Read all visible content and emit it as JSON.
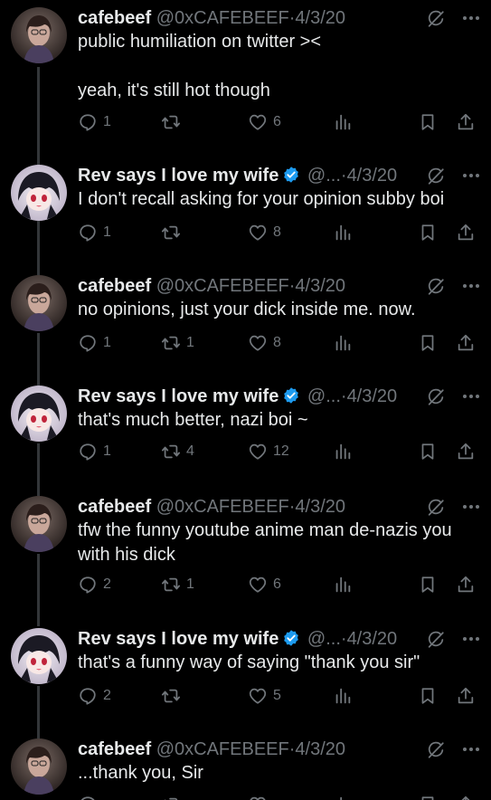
{
  "colors": {
    "background": "#000000",
    "text": "#e7e9ea",
    "muted": "#71767b",
    "verified": "#1d9bf0",
    "thread_line": "#333639"
  },
  "icons": [
    "reply-icon",
    "retweet-icon",
    "like-icon",
    "views-icon",
    "bookmark-icon",
    "share-icon",
    "grok-icon",
    "more-icon",
    "verified-badge-icon"
  ],
  "tweets": [
    {
      "author": "cafebeef",
      "handle": "@0xCAFEBEEF",
      "sep": "·",
      "date": "4/3/20",
      "text": "public humiliation on twitter ><\n\nyeah, it's still hot though",
      "replies": "1",
      "retweets": "",
      "likes": "6"
    },
    {
      "author": "Rev says I love my wife",
      "handle": "@...",
      "sep": "·",
      "date": "4/3/20",
      "text": "I don't recall asking for your opinion subby boi",
      "replies": "1",
      "retweets": "",
      "likes": "8"
    },
    {
      "author": "cafebeef",
      "handle": "@0xCAFEBEEF",
      "sep": "·",
      "date": "4/3/20",
      "text": "no opinions, just your dick inside me. now.",
      "replies": "1",
      "retweets": "1",
      "likes": "8"
    },
    {
      "author": "Rev says I love my wife",
      "handle": "@...",
      "sep": "·",
      "date": "4/3/20",
      "text": "that's much better, nazi boi ~",
      "replies": "1",
      "retweets": "4",
      "likes": "12"
    },
    {
      "author": "cafebeef",
      "handle": "@0xCAFEBEEF",
      "sep": "·",
      "date": "4/3/20",
      "text": "tfw the funny youtube anime man de-nazis you with his dick",
      "replies": "2",
      "retweets": "1",
      "likes": "6"
    },
    {
      "author": "Rev says I love my wife",
      "handle": "@...",
      "sep": "·",
      "date": "4/3/20",
      "text": "that's a funny way of saying \"thank you sir\"",
      "replies": "2",
      "retweets": "",
      "likes": "5"
    },
    {
      "author": "cafebeef",
      "handle": "@0xCAFEBEEF",
      "sep": "·",
      "date": "4/3/20",
      "text": "...thank you, Sir",
      "replies": "",
      "retweets": "",
      "likes": ""
    }
  ]
}
